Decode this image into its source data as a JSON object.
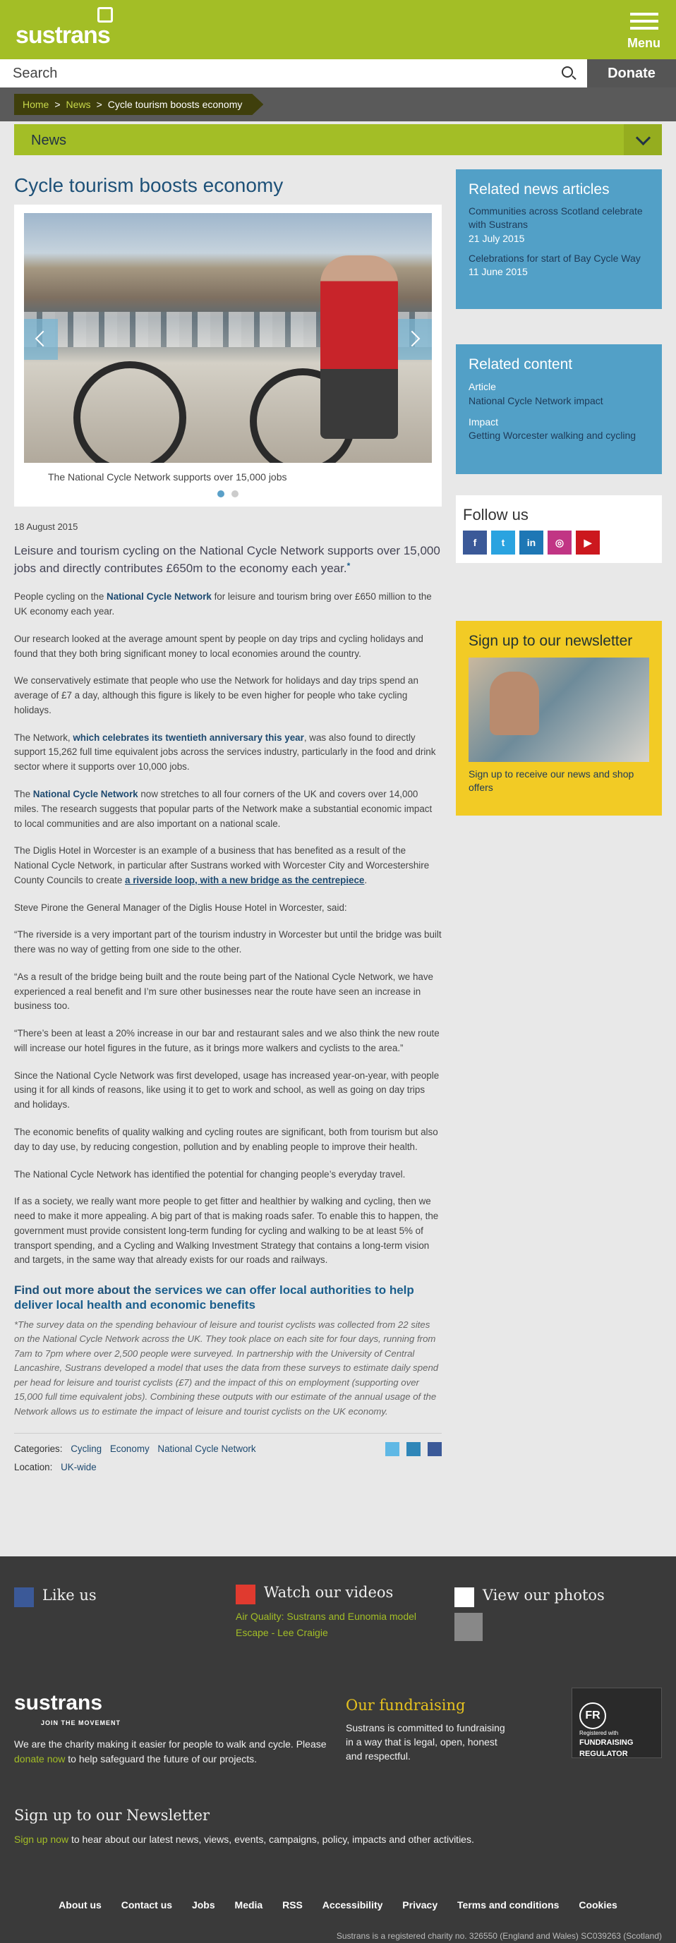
{
  "header": {
    "logo": "sustrans",
    "menu_label": "Menu",
    "search_placeholder": "Search",
    "donate_label": "Donate"
  },
  "breadcrumb": [
    "Home",
    "News",
    "Cycle tourism boosts economy"
  ],
  "section_bar": "News",
  "article": {
    "title": "Cycle tourism boosts economy",
    "image_caption": "The National Cycle Network supports over 15,000 jobs",
    "date": "18 August 2015",
    "lead": "Leisure and tourism cycling on the National Cycle Network supports over 15,000 jobs and directly contributes £650m to the economy each year.",
    "lead_link": "*",
    "p1_a": "People cycling on the ",
    "p1_link": "National Cycle Network",
    "p1_b": " for leisure and tourism bring over £650 million to the UK economy each year.",
    "p2": "Our research looked at the average amount spent by people on day trips and cycling holidays and found that they both bring significant money to local economies around the country.",
    "p3": "We conservatively estimate that people who use the Network for holidays and day trips spend an average of £7 a day, although this figure is likely to be even higher for people who take cycling holidays.",
    "p4_a": "The Network, ",
    "p4_link": "which celebrates its twentieth anniversary this year",
    "p4_b": ", was also found to directly support 15,262 full time equivalent jobs across the services industry, particularly in the food and drink sector where it supports over 10,000 jobs.",
    "p5_a": "The ",
    "p5_link": "National Cycle Network",
    "p5_b": " now stretches to all four corners of the UK and covers over 14,000 miles. The research suggests that popular parts of the Network make a substantial economic impact to local communities and are also important on a national scale.",
    "p6_a": "The Diglis Hotel in Worcester is an example of a business that has benefited as a result of the National Cycle Network, in particular after Sustrans worked with Worcester City and Worcestershire County Councils to create ",
    "p6_link": "a riverside loop, with a new bridge as the centrepiece",
    "p6_b": ".",
    "p7": "Steve Pirone the General Manager of the Diglis House Hotel in Worcester, said:",
    "p8": "“The riverside is a very important part of the tourism industry in Worcester but until the bridge was built there was no way of getting from one side to the other.",
    "p9": "“As a result of the bridge being built and the route being part of the National Cycle Network, we have experienced a real benefit and I’m sure other businesses near the route have seen an increase in business too.",
    "p10": "“There’s been at least a 20% increase in our bar and restaurant sales and we also think the new route will increase our hotel figures in the future, as it brings more walkers and cyclists to the area.”",
    "p11": "Since the National Cycle Network was first developed, usage has increased year-on-year, with people using it for all kinds of reasons, like using it to get to work and school, as well as going on day trips and holidays.",
    "p12": "The economic benefits of quality walking and cycling routes are significant, both from tourism but also day to day use, by reducing congestion, pollution and by enabling people to improve their health.",
    "p13": "The National Cycle Network has identified the potential for changing people’s everyday travel.",
    "p14": "If as a society, we really want more people to get fitter and healthier by walking and cycling, then we need to make it more appealing. A big part of that is making roads safer. To enable this to happen, the government must provide consistent long-term funding for cycling and walking to be at least 5% of transport spending, and a Cycling and Walking Investment Strategy that contains a long-term vision and targets, in the same way that already exists for our roads and railways.",
    "h2_a": "Find out more about the ",
    "h2_link": "services we can offer local authorities to help deliver local health and economic benefits",
    "note": "*The survey data on the spending behaviour of leisure and tourist cyclists was collected from 22 sites on the National Cycle Network across the UK. They took place on each site for four days, running from 7am to 7pm where over 2,500 people were surveyed. In partnership with the University of Central Lancashire, Sustrans developed a model that uses the data from these surveys to estimate daily spend per head for leisure and tourist cyclists (£7) and the impact of this on employment (supporting over 15,000 full time equivalent jobs). Combining these outputs with our estimate of the annual usage of the Network allows us to estimate the impact of leisure and tourist cyclists on the UK economy.",
    "categories_label": "Categories:",
    "categories": [
      "Cycling",
      "Economy",
      "National Cycle Network"
    ],
    "location_label": "Location:",
    "location": "UK-wide"
  },
  "sidebar": {
    "related_news_title": "Related news articles",
    "related_news": [
      {
        "title": "Communities across Scotland celebrate with Sustrans",
        "date": "21 July 2015"
      },
      {
        "title": "Celebrations for start of Bay Cycle Way",
        "date": "11 June 2015"
      }
    ],
    "related_content_title": "Related content",
    "related_content": [
      {
        "type": "Article",
        "title": "National Cycle Network impact"
      },
      {
        "type": "Impact",
        "title": "Getting Worcester walking and cycling"
      }
    ],
    "follow_title": "Follow us",
    "newsletter_title": "Sign up to our newsletter",
    "newsletter_text": "Sign up to receive our news and shop offers"
  },
  "footer": {
    "like_us": "Like us",
    "watch_videos": "Watch our videos",
    "videos": [
      "Air Quality: Sustrans and Eunomia model",
      "Escape - Lee Craigie"
    ],
    "view_photos": "View our photos",
    "logo": "sustrans",
    "logo_tagline": "JOIN THE MOVEMENT",
    "about_a": "We are the charity making it easier for people to walk and cycle. Please ",
    "about_link": "donate now",
    "about_b": " to help safeguard the future of our projects.",
    "fundraising_title": "Our fundraising",
    "fundraising_text": "Sustrans is committed to fundraising in a way that is legal, open, honest and respectful.",
    "regulator_small": "Registered with",
    "regulator": "FUNDRAISING REGULATOR",
    "newsletter_title": "Sign up to our Newsletter",
    "newsletter_link": "Sign up now",
    "newsletter_text": " to hear about our latest news, views, events, campaigns, policy, impacts and other activities.",
    "nav": [
      "About us",
      "Contact us",
      "Jobs",
      "Media",
      "RSS",
      "Accessibility",
      "Privacy",
      "Terms and conditions",
      "Cookies"
    ],
    "legal": "Sustrans is a registered charity no. 326550 (England and Wales) SC039263 (Scotland)"
  },
  "colors": {
    "brand_green": "#a3be26",
    "sidebar_blue": "#52a0c7",
    "newsletter_yellow": "#f2cb25",
    "footer_bg": "#3a3a3a"
  }
}
